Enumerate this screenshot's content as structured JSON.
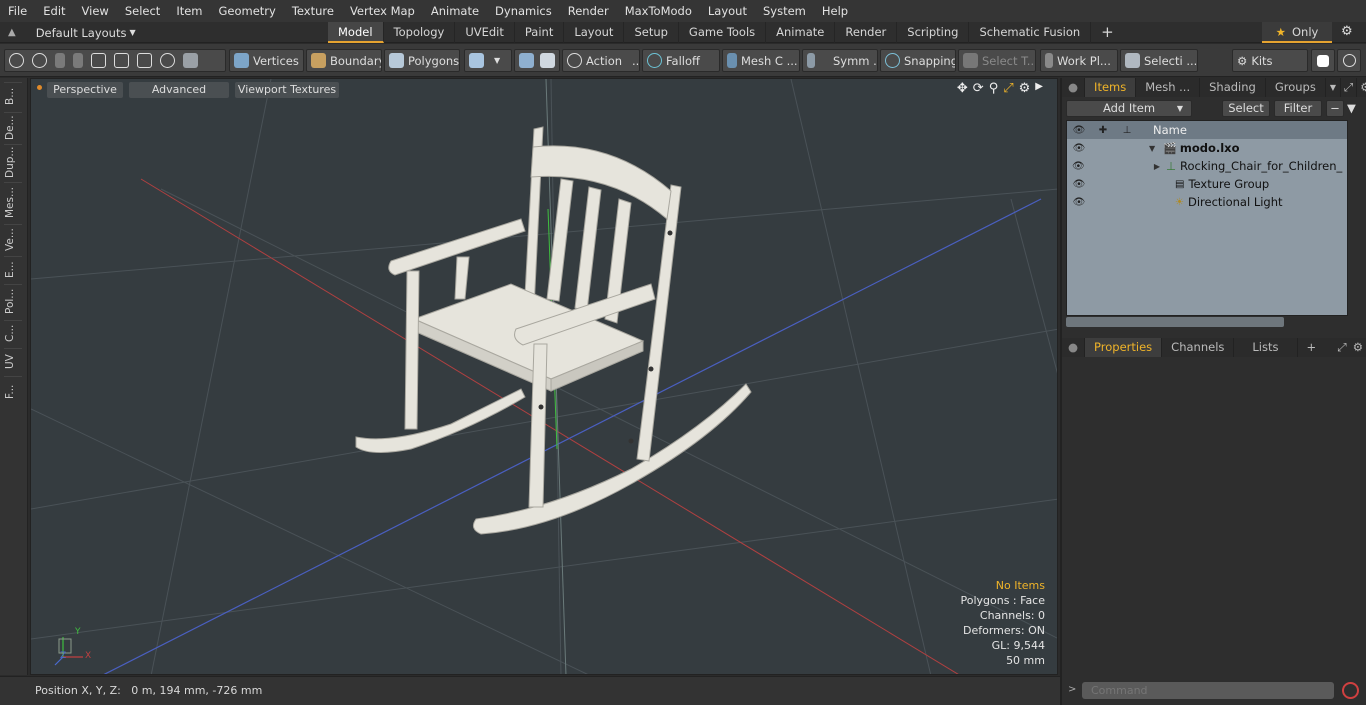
{
  "menu": [
    "File",
    "Edit",
    "View",
    "Select",
    "Item",
    "Geometry",
    "Texture",
    "Vertex Map",
    "Animate",
    "Dynamics",
    "Render",
    "MaxToModo",
    "Layout",
    "System",
    "Help"
  ],
  "layout_selector": "Default Layouts",
  "tabs": [
    "Model",
    "Topology",
    "UVEdit",
    "Paint",
    "Layout",
    "Setup",
    "Game Tools",
    "Animate",
    "Render",
    "Scripting",
    "Schematic Fusion"
  ],
  "only_label": "Only",
  "toolbar": {
    "vertices": "Vertices",
    "boundary": "Boundary",
    "polygons": "Polygons",
    "action": "Action",
    "falloff": "Falloff",
    "mesh": "Mesh C ...",
    "symm": "Symm ...",
    "snapping": "Snapping",
    "select_t": "Select T...",
    "work_pl": "Work Pl...",
    "selecti": "Selecti ...",
    "kits": "Kits"
  },
  "left_tabs": [
    "B...",
    "De...",
    "Dup...",
    "Mes...",
    "Ve...",
    "E...",
    "Pol...",
    "C...",
    "UV",
    "F..."
  ],
  "viewport": {
    "perspective": "Perspective",
    "advanced": "Advanced",
    "textures": "Viewport Textures",
    "info": {
      "no_items": "No Items",
      "polygons": "Polygons : Face",
      "channels": "Channels: 0",
      "deformers": "Deformers: ON",
      "gl": "GL: 9,544",
      "size": "50 mm"
    },
    "axes": {
      "x": "X",
      "y": "Y",
      "z": "Z"
    }
  },
  "status": {
    "position": "Position X, Y, Z:   0 m, 194 mm, -726 mm"
  },
  "items_panel": {
    "tabs": [
      "Items",
      "Mesh ...",
      "Shading",
      "Groups"
    ],
    "add_item": "Add Item",
    "select": "Select",
    "filter": "Filter",
    "name_header": "Name",
    "rows": [
      "modo.lxo",
      "Rocking_Chair_for_Children_ ...",
      "Texture Group",
      "Directional Light"
    ]
  },
  "props_panel": {
    "tabs": [
      "Properties",
      "Channels",
      "Lists"
    ]
  },
  "command": {
    "placeholder": "Command"
  }
}
